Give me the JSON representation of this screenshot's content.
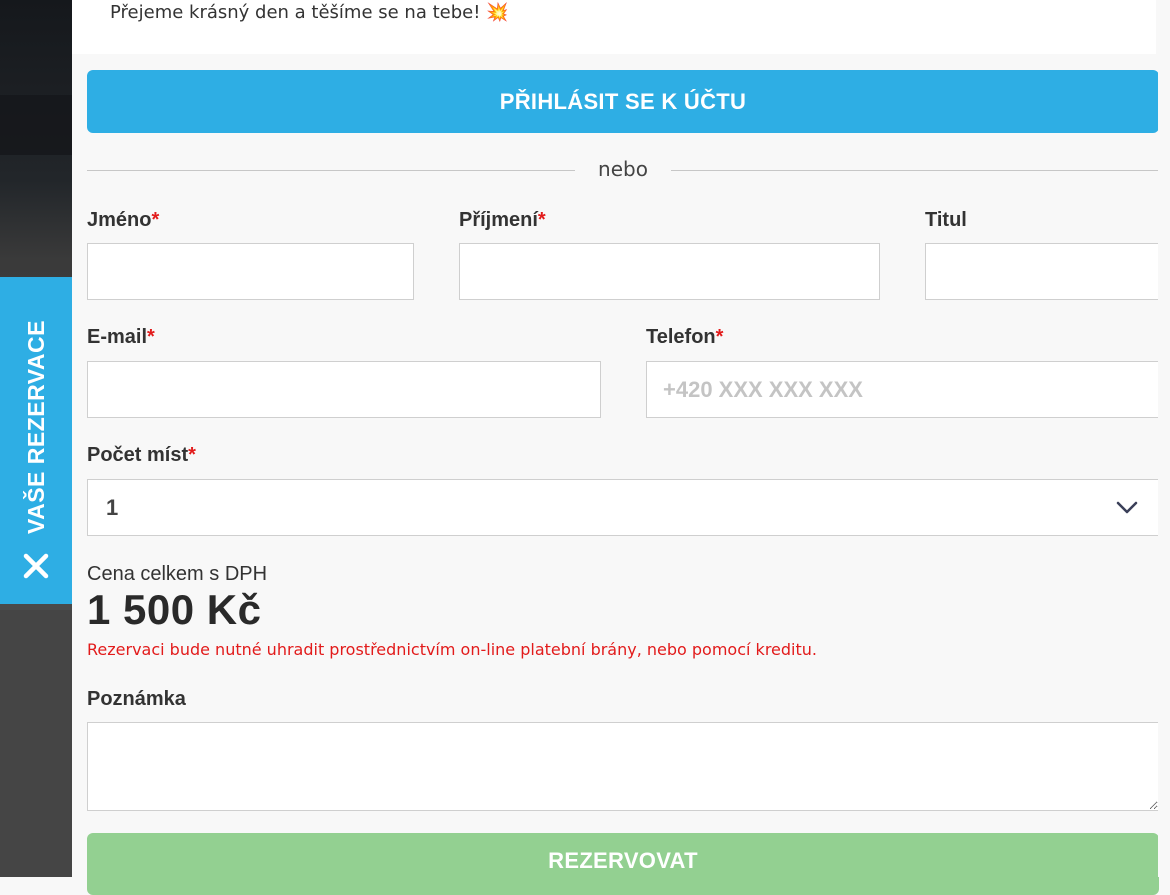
{
  "side_tab": {
    "label": "VAŠE REZERVACE"
  },
  "greeting": {
    "text": "Přejeme krásný den a těšíme se na tebe!",
    "emoji": "💥"
  },
  "login_button": {
    "label": "PŘIHLÁSIT SE K ÚČTU"
  },
  "divider": {
    "text": "nebo"
  },
  "form": {
    "first_name": {
      "label": "Jméno",
      "required_mark": "*",
      "value": ""
    },
    "last_name": {
      "label": "Příjmení",
      "required_mark": "*",
      "value": ""
    },
    "title": {
      "label": "Titul",
      "value": ""
    },
    "email": {
      "label": "E-mail",
      "required_mark": "*",
      "value": ""
    },
    "phone": {
      "label": "Telefon",
      "required_mark": "*",
      "placeholder": "+420 XXX XXX XXX",
      "value": ""
    },
    "seats": {
      "label": "Počet míst",
      "required_mark": "*",
      "selected": "1"
    },
    "note": {
      "label": "Poznámka",
      "value": ""
    }
  },
  "price": {
    "label": "Cena celkem s DPH",
    "value": "1 500 Kč",
    "notice": "Rezervaci bude nutné uhradit prostřednictvím on-line platební brány, nebo pomocí kreditu."
  },
  "submit_button": {
    "label": "REZERVOVAT"
  },
  "colors": {
    "primary": "#2eaee4",
    "success": "#93d091",
    "required": "#e21b1b"
  }
}
